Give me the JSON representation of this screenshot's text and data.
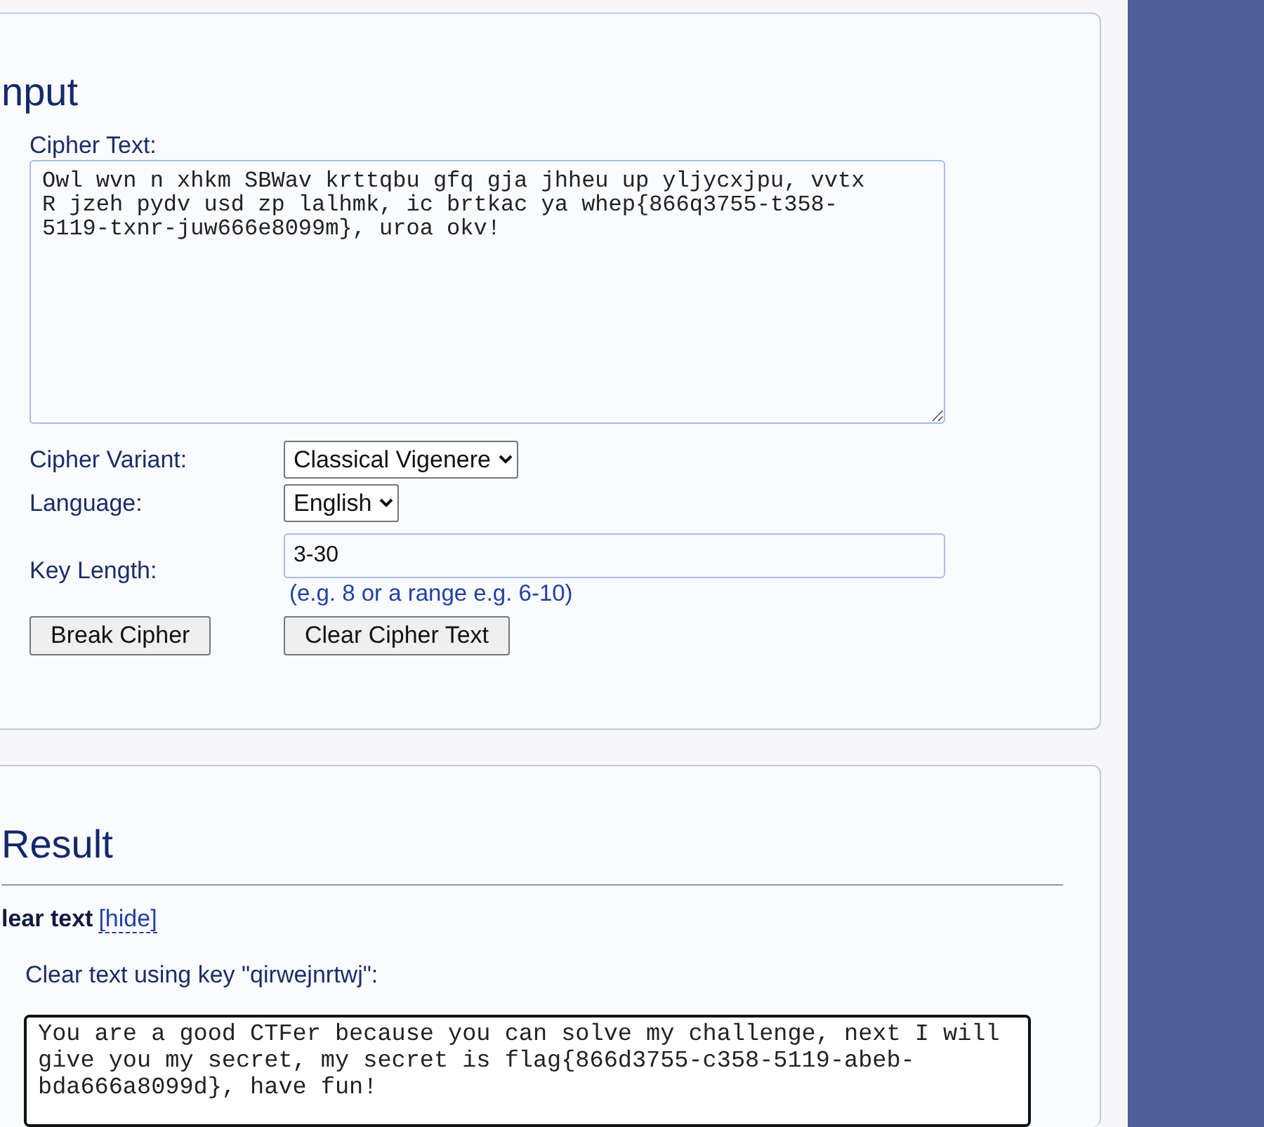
{
  "input_panel": {
    "heading": "nput",
    "cipher_text_label": "Cipher Text:",
    "cipher_text": "Owl wvn n xhkm SBWav krttqbu gfq gja jhheu up yljycxjpu, vvtx R jzeh pydv usd zp lalhmk, ic brtkac ya whep{866q3755-t358-5119-txnr-juw666e8099m}, uroa okv!",
    "fields": [
      {
        "kind": "select",
        "label": "Cipher Variant:",
        "value": "Classical Vigenere"
      },
      {
        "kind": "select",
        "label": "Language:",
        "value": "English"
      },
      {
        "kind": "text",
        "label": "Key Length:",
        "value": "3-30",
        "hint": "(e.g. 8 or a range e.g. 6-10)"
      }
    ],
    "buttons": [
      "Break Cipher",
      "Clear Cipher Text"
    ]
  },
  "result_panel": {
    "heading": "Result",
    "section_title": "lear text",
    "toggle_link": "[hide]",
    "key_line": "Clear text using key \"qirwejnrtwj\":",
    "clear_text": "You are a good CTFer because you can solve my challenge, next I will give you my secret, my secret is flag{866d3755-c358-5119-abeb-bda666a8099d}, have fun!"
  }
}
